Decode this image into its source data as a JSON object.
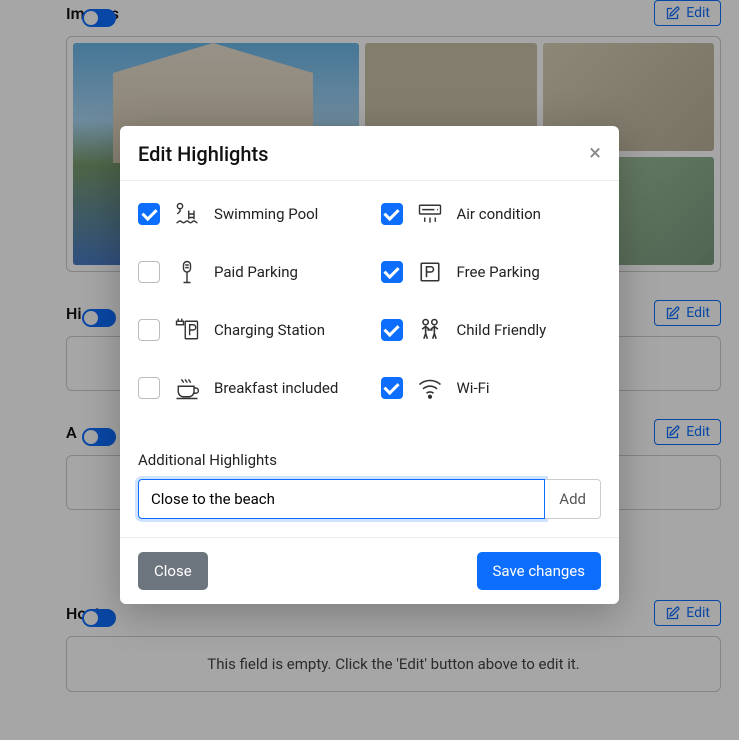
{
  "sections": {
    "images": {
      "title": "Images",
      "edit": "Edit"
    },
    "highlights": {
      "title": "Hi",
      "edit": "Edit"
    },
    "about": {
      "title": "A",
      "edit": "Edit"
    },
    "host": {
      "title": "Host",
      "edit": "Edit",
      "empty": "This field is empty. Click the 'Edit' button above to edit it."
    }
  },
  "modal": {
    "title": "Edit Highlights",
    "amenities": [
      {
        "label": "Swimming Pool",
        "checked": true,
        "icon": "pool-icon"
      },
      {
        "label": "Air condition",
        "checked": true,
        "icon": "ac-icon"
      },
      {
        "label": "Paid Parking",
        "checked": false,
        "icon": "paid-parking-icon"
      },
      {
        "label": "Free Parking",
        "checked": true,
        "icon": "free-parking-icon"
      },
      {
        "label": "Charging Station",
        "checked": false,
        "icon": "charging-icon"
      },
      {
        "label": "Child Friendly",
        "checked": true,
        "icon": "child-icon"
      },
      {
        "label": "Breakfast included",
        "checked": false,
        "icon": "breakfast-icon"
      },
      {
        "label": "Wi-Fi",
        "checked": true,
        "icon": "wifi-icon"
      }
    ],
    "additional": {
      "label": "Additional Highlights",
      "value": "Close to the beach",
      "add": "Add"
    },
    "footer": {
      "close": "Close",
      "save": "Save changes"
    }
  }
}
